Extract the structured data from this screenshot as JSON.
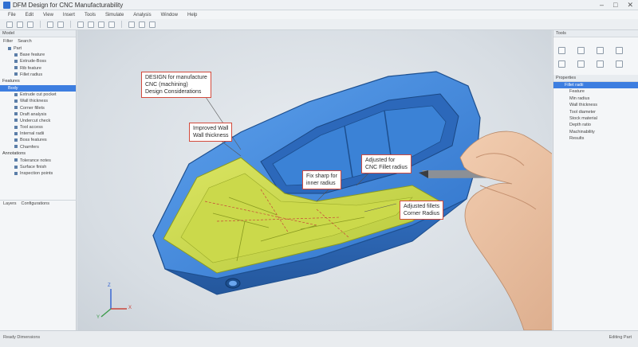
{
  "window": {
    "title": "DFM  Design for CNC Manufacturability"
  },
  "menu": [
    "File",
    "Edit",
    "View",
    "Insert",
    "Tools",
    "Simulate",
    "Analysis",
    "Window",
    "Help"
  ],
  "left_panel": {
    "header": "Model",
    "tabs": [
      "Filter",
      "Search"
    ],
    "top_items": [
      "Part",
      "Base feature",
      "Extrude-Boss",
      "Rib feature",
      "Fillet radius"
    ],
    "section_label": "Features",
    "selected_item": "Body",
    "tree_items": [
      "Extrude cut pocket",
      "Wall thickness",
      "Corner fillets",
      "Draft analysis",
      "Undercut check",
      "Tool access",
      "Internal radii",
      "Boss features",
      "Chamfers"
    ],
    "section2": "Annotations",
    "tree_items2": [
      "Tolerance notes",
      "Surface finish",
      "Inspection points"
    ],
    "footer": [
      "Layers",
      "Configurations"
    ]
  },
  "right_panel": {
    "header": "Tools",
    "section": "Properties",
    "selected_item": "Fillet radii",
    "items": [
      "Feature",
      "Min radius",
      "Wall thickness",
      "Tool diameter",
      "Stock material",
      "Depth ratio",
      "Machinability",
      "Results"
    ]
  },
  "callouts": {
    "design": "DESIGN for manufacture\nCNC (machining)\nDesign Considerations",
    "wall": "Improved Wall\nWall thickness",
    "adjusted": "Adjusted for\nCNC Fillet radius",
    "fillet": "Fix sharp for\ninner radius",
    "corner": "Adjusted fillets\nCorner Radius"
  },
  "status": {
    "left": "Ready  Dimensions",
    "right": "Editing Part"
  },
  "axis": {
    "x": "X",
    "y": "Y",
    "z": "Z"
  },
  "colors": {
    "part_blue": "#3b82d6",
    "part_yellow": "#c9d94a",
    "callout_border": "#d24a3c",
    "selection": "#3d7ee0"
  }
}
